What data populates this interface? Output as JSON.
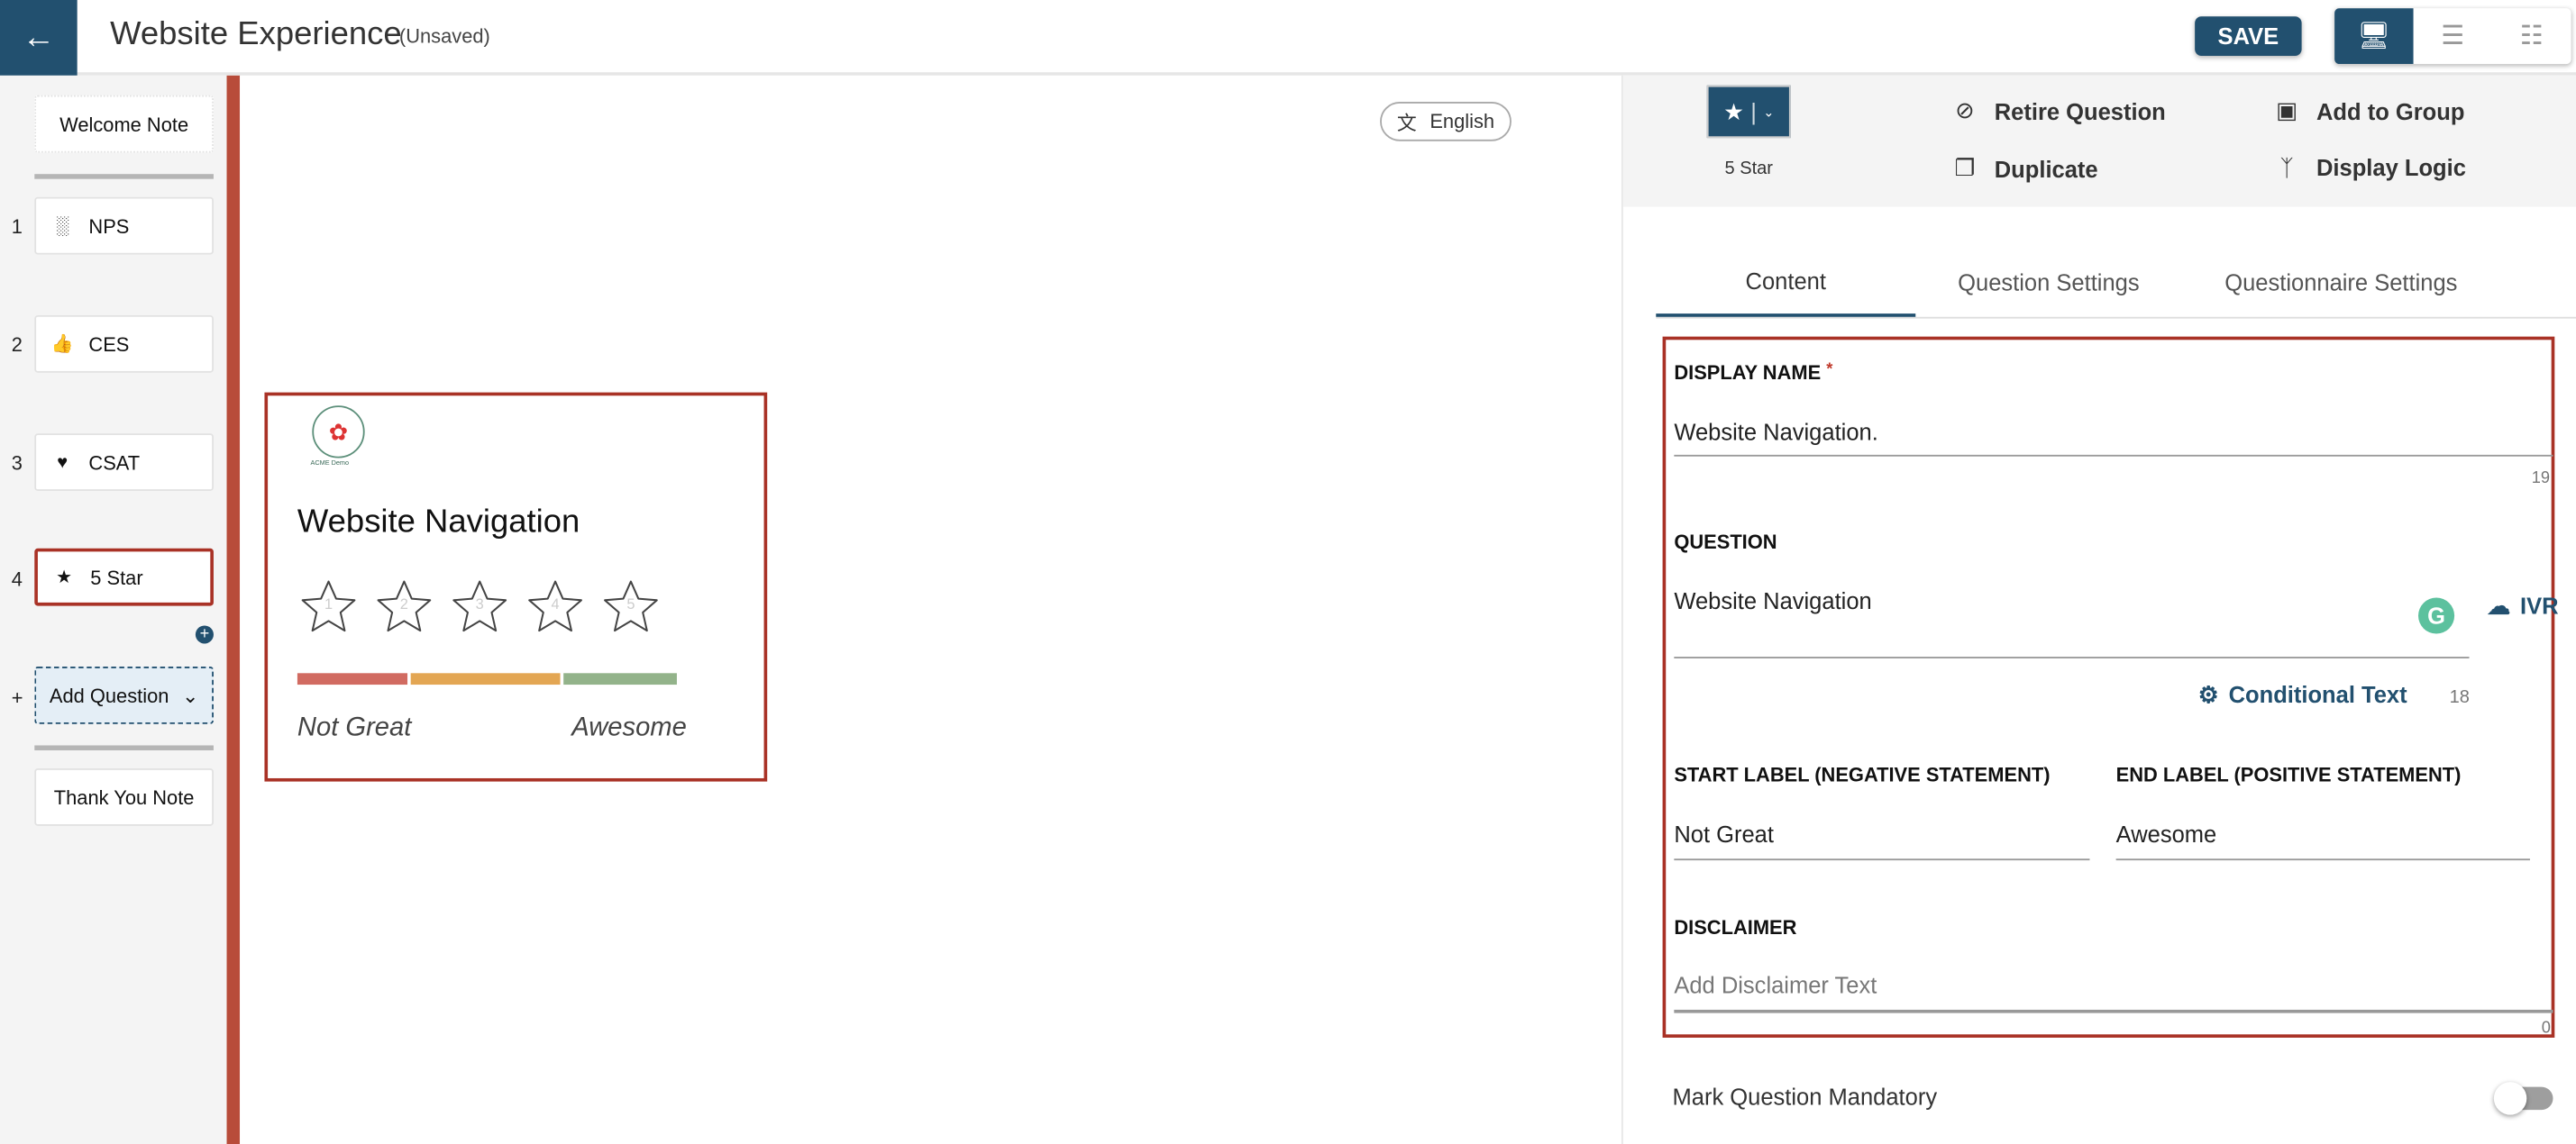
{
  "header": {
    "title": "Website Experience",
    "status": "(Unsaved)",
    "save_label": "SAVE",
    "back_icon": "arrow-left-icon",
    "views": [
      "desktop-icon",
      "list-icon",
      "sitemap-icon"
    ]
  },
  "sidebar": {
    "welcome": "Welcome Note",
    "questions": [
      {
        "num": "1",
        "label": "NPS",
        "icon": "nps-icon"
      },
      {
        "num": "2",
        "label": "CES",
        "icon": "thumbs-up-icon"
      },
      {
        "num": "3",
        "label": "CSAT",
        "icon": "heart-icon"
      },
      {
        "num": "4",
        "label": "5 Star",
        "icon": "star-icon",
        "selected": true
      }
    ],
    "add_prefix": "+",
    "add_question": "Add Question",
    "thank_you": "Thank You Note"
  },
  "preview": {
    "language": "English",
    "logo_text": "ACME Demo",
    "question": "Website Navigation",
    "stars": [
      "1",
      "2",
      "3",
      "4",
      "5"
    ],
    "scale_colors": [
      "#d16b61",
      "#e3a653",
      "#93b38a"
    ],
    "start_label": "Not Great",
    "end_label": "Awesome"
  },
  "panel": {
    "type_label": "5 Star",
    "actions": {
      "retire": "Retire Question",
      "add_group": "Add to Group",
      "duplicate": "Duplicate",
      "display_logic": "Display Logic"
    },
    "tabs": [
      "Content",
      "Question Settings",
      "Questionnaire Settings"
    ],
    "active_tab": "Content",
    "display_name_label": "DISPLAY NAME",
    "required_mark": "*",
    "display_name_value": "Website Navigation.",
    "display_name_count": "19",
    "question_label": "QUESTION",
    "question_value": "Website Navigation",
    "ivr_label": "IVR",
    "conditional_text": "Conditional Text",
    "question_count": "18",
    "start_label_title": "START LABEL (NEGATIVE STATEMENT)",
    "start_label_value": "Not Great",
    "end_label_title": "END LABEL (POSITIVE STATEMENT)",
    "end_label_value": "Awesome",
    "disclaimer_label": "DISCLAIMER",
    "disclaimer_placeholder": "Add Disclaimer Text",
    "disclaimer_count": "0",
    "mandatory_label": "Mark Question Mandatory",
    "mandatory_on": false
  },
  "colors": {
    "primary": "#22506f",
    "highlight": "#a93226",
    "accent_bar": "#b84c3a"
  }
}
